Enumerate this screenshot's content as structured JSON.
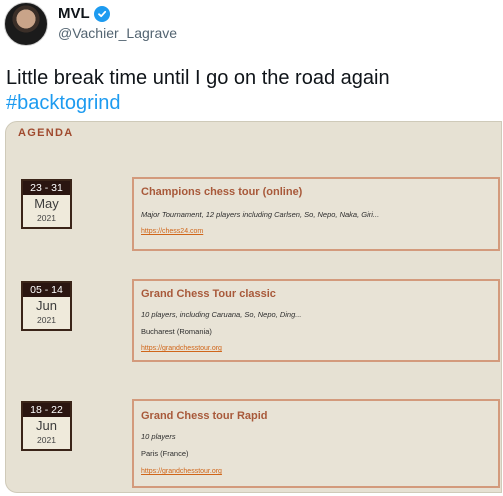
{
  "tweet": {
    "display_name": "MVL",
    "handle": "@Vachier_Lagrave",
    "text": "Little break time until I go on the road again",
    "hashtag": "#backtogrind"
  },
  "agenda": {
    "title": "AGENDA",
    "events": [
      {
        "date_range": "23 - 31",
        "month": "May",
        "year": "2021",
        "title": "Champions chess tour (online)",
        "description": "Major Tournament, 12 players including Carlsen, So, Nepo, Naka, Giri...",
        "location": "",
        "link": "https://chess24.com"
      },
      {
        "date_range": "05 - 14",
        "month": "Jun",
        "year": "2021",
        "title": "Grand Chess Tour classic",
        "description": "10 players, including Caruana, So, Nepo, Ding...",
        "location": "Bucharest (Romania)",
        "link": "https://grandchesstour.org"
      },
      {
        "date_range": "18 - 22",
        "month": "Jun",
        "year": "2021",
        "title": "Grand Chess tour Rapid",
        "description": "10 players",
        "location": "Paris (France)",
        "link": "https://grandchesstour.org"
      }
    ]
  },
  "colors": {
    "hashtag": "#1d9bf0",
    "verified": "#1d9bf0",
    "event_title": "#a8593a",
    "link": "#d0661a"
  }
}
